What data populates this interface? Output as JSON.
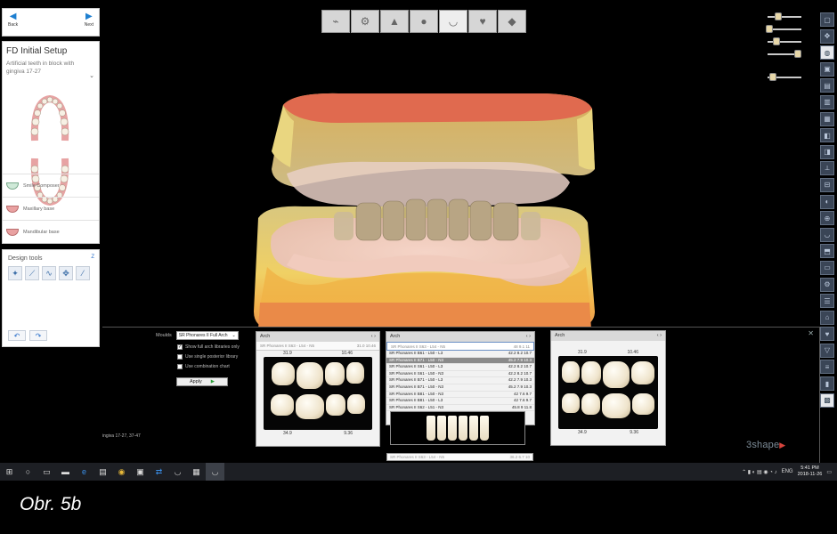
{
  "nav": {
    "back_label": "Back",
    "next_label": "Next"
  },
  "left_panel": {
    "title": "FD Initial Setup",
    "subtitle": "Artificial teeth in block with gingiva 17-27",
    "items": [
      {
        "label": "Smile Composer"
      },
      {
        "label": "Maxillary base"
      },
      {
        "label": "Mandibular base"
      }
    ]
  },
  "design_tools": {
    "title": "Design tools",
    "corner": "Z"
  },
  "top_toolbar": {
    "icons": [
      "scan-icon",
      "prep-icon",
      "tooth-icon",
      "model-icon",
      "gingiva-icon",
      "heart-icon",
      "finish-icon"
    ],
    "active_index": 4
  },
  "bottom_panel": {
    "mould_label": "Moulds",
    "mould_value": "SR Phonares II Full Arch",
    "options": [
      {
        "label": "Show full arch libraries only",
        "checked": true
      },
      {
        "label": "Use single posterior library",
        "checked": false
      },
      {
        "label": "Use combination chart",
        "checked": false
      }
    ],
    "apply_label": "Apply",
    "left_note": "ingiva 17-27, 37-47",
    "upper_panel": {
      "header": "Arch",
      "library": "SR Phonares II S63 - L54 - N5",
      "dims": "31.0 10.46",
      "top_dims": [
        "31.9",
        "10.46"
      ],
      "bottom_dims": [
        "34.9",
        "9.36"
      ]
    },
    "middle_panel": {
      "header": "Arch",
      "selected_value": "SR Phonares II S63 - L54 - N5",
      "selected_dims": "48 9.1 11",
      "list": [
        {
          "name": "SR Phonares II B61 - L50 - L3",
          "dims": "42.2 8.2 10.7",
          "sel": false
        },
        {
          "name": "SR Phonares II B71 - L50 - N3",
          "dims": "45.2 7.9 10.3",
          "sel": true
        },
        {
          "name": "SR Phonares II S61 - L50 - L3",
          "dims": "42.2 8.2 10.7",
          "sel": false
        },
        {
          "name": "SR Phonares II S61 - L50 - N3",
          "dims": "42.2 8.2 10.7",
          "sel": false
        },
        {
          "name": "SR Phonares II B71 - L50 - L3",
          "dims": "42.2 7.9 10.3",
          "sel": false
        },
        {
          "name": "SR Phonares II B71 - L50 - N3",
          "dims": "45.2 7.9 10.3",
          "sel": false
        },
        {
          "name": "SR Phonares II B81 - L50 - N3",
          "dims": "42 7.6 9.7",
          "sel": false
        },
        {
          "name": "SR Phonares II B81 - L50 - L3",
          "dims": "42 7.6 9.7",
          "sel": false
        },
        {
          "name": "SR Phonares II S62 - L51 - N3",
          "dims": "45.8 9 11.8",
          "sel": false
        }
      ],
      "below_value": "SR Phonares II S63 - L54 - N5",
      "below_dims": "36.2 6.7 10"
    },
    "right_panel": {
      "header": "Arch",
      "top_dims": [
        "31.9",
        "10.46"
      ],
      "bottom_dims": [
        "34.9",
        "9.36"
      ]
    }
  },
  "brand": "3shape",
  "taskbar": {
    "icons": [
      "windows-start-icon",
      "search-icon",
      "task-view-icon",
      "file-explorer-icon",
      "edge-icon",
      "store-icon",
      "chrome-icon",
      "app-icon",
      "teamviewer-icon",
      "dental-app-icon",
      "dental-app-2-icon",
      "dental-system-icon"
    ],
    "language": "ENG",
    "time": "5:41 PM",
    "date": "2018-11-26"
  },
  "caption": "Obr. 5b"
}
